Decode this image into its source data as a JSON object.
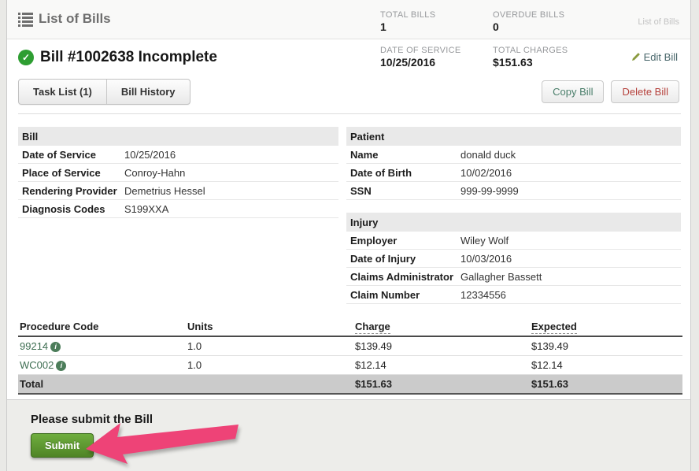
{
  "colors": {
    "accent_green": "#2e9e32",
    "arrow_pink": "#ee4377",
    "link_green": "#3e6e52",
    "delete_red": "#b5413c"
  },
  "icons": {
    "check_glyph": "✓",
    "info_glyph": "i",
    "list_icon": "list-icon",
    "pencil_icon": "pencil-icon"
  },
  "topbar": {
    "title": "List of Bills",
    "stats": [
      {
        "label": "TOTAL BILLS",
        "value": "1"
      },
      {
        "label": "OVERDUE BILLS",
        "value": "0"
      }
    ],
    "breadcrumb": "List of Bills"
  },
  "bill_header": {
    "title": "Bill #1002638 Incomplete",
    "stats": [
      {
        "label": "DATE OF SERVICE",
        "value": "10/25/2016"
      },
      {
        "label": "TOTAL CHARGES",
        "value": "$151.63"
      }
    ],
    "edit_label": "Edit Bill"
  },
  "tabs": [
    {
      "label": "Task List (1)"
    },
    {
      "label": "Bill History"
    }
  ],
  "actions": {
    "copy_label": "Copy Bill",
    "delete_label": "Delete Bill"
  },
  "sections": {
    "bill": {
      "title": "Bill",
      "rows": [
        {
          "label": "Date of Service",
          "value": "10/25/2016"
        },
        {
          "label": "Place of Service",
          "value": "Conroy-Hahn"
        },
        {
          "label": "Rendering Provider",
          "value": "Demetrius Hessel"
        },
        {
          "label": "Diagnosis Codes",
          "value": "S199XXA"
        }
      ]
    },
    "patient": {
      "title": "Patient",
      "rows": [
        {
          "label": "Name",
          "value": "donald duck"
        },
        {
          "label": "Date of Birth",
          "value": "10/02/2016"
        },
        {
          "label": "SSN",
          "value": "999-99-9999"
        }
      ]
    },
    "injury": {
      "title": "Injury",
      "rows": [
        {
          "label": "Employer",
          "value": "Wiley Wolf"
        },
        {
          "label": "Date of Injury",
          "value": "10/03/2016"
        },
        {
          "label": "Claims Administrator",
          "value": "Gallagher Bassett"
        },
        {
          "label": "Claim Number",
          "value": "12334556"
        }
      ]
    }
  },
  "procedures": {
    "headers": [
      "Procedure Code",
      "Units",
      "Charge",
      "Expected"
    ],
    "rows": [
      {
        "code": "99214",
        "units": "1.0",
        "charge": "$139.49",
        "expected": "$139.49"
      },
      {
        "code": "WC002",
        "units": "1.0",
        "charge": "$12.14",
        "expected": "$12.14"
      }
    ],
    "total": {
      "label": "Total",
      "charge": "$151.63",
      "expected": "$151.63"
    }
  },
  "footer": {
    "message": "Please submit the Bill",
    "submit_label": "Submit"
  }
}
